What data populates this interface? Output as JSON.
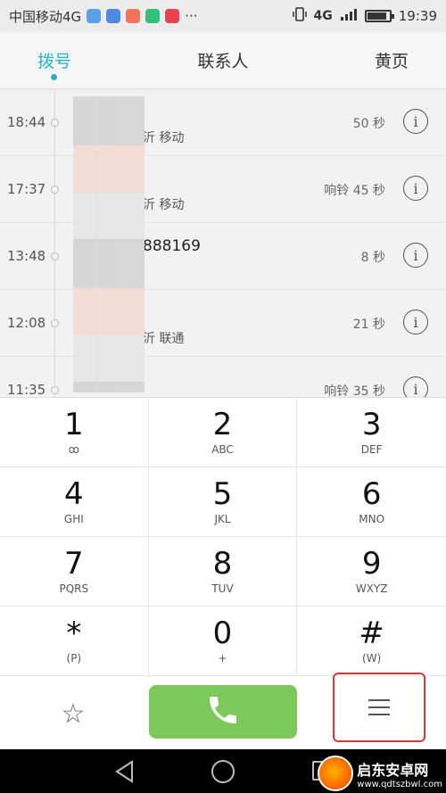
{
  "status_bar": {
    "carrier": "中国移动4G",
    "more": "···",
    "network": "4G",
    "time": "19:39"
  },
  "tabs": [
    {
      "label": "拨号",
      "active": true
    },
    {
      "label": "联系人",
      "active": false
    },
    {
      "label": "黄页",
      "active": false
    }
  ],
  "call_log": [
    {
      "time": "18:44",
      "name": "",
      "location": "沂 移动",
      "duration": "50 秒"
    },
    {
      "time": "17:37",
      "name": "",
      "location": "沂 移动",
      "duration": "响铃 45 秒"
    },
    {
      "time": "13:48",
      "name": "888169",
      "location": "",
      "duration": "8 秒"
    },
    {
      "time": "12:08",
      "name": "",
      "location": "沂 联通",
      "duration": "21 秒"
    },
    {
      "time": "11:35",
      "name": "",
      "location": "",
      "duration": "响铃 35 秒"
    }
  ],
  "info_glyph": "i",
  "keypad": [
    {
      "digit": "1",
      "letters": "ꝏ"
    },
    {
      "digit": "2",
      "letters": "ABC"
    },
    {
      "digit": "3",
      "letters": "DEF"
    },
    {
      "digit": "4",
      "letters": "GHI"
    },
    {
      "digit": "5",
      "letters": "JKL"
    },
    {
      "digit": "6",
      "letters": "MNO"
    },
    {
      "digit": "7",
      "letters": "PQRS"
    },
    {
      "digit": "8",
      "letters": "TUV"
    },
    {
      "digit": "9",
      "letters": "WXYZ"
    },
    {
      "digit": "*",
      "letters": "(P)"
    },
    {
      "digit": "0",
      "letters": "+"
    },
    {
      "digit": "#",
      "letters": "(W)"
    }
  ],
  "action_bar": {
    "star_glyph": "☆",
    "call_color": "#7cc85a",
    "highlight_color": "#d9383a"
  },
  "accent_color": "#26b4c8",
  "watermark": {
    "title": "启东安卓网",
    "url": "www.qdtszbwl.com"
  }
}
